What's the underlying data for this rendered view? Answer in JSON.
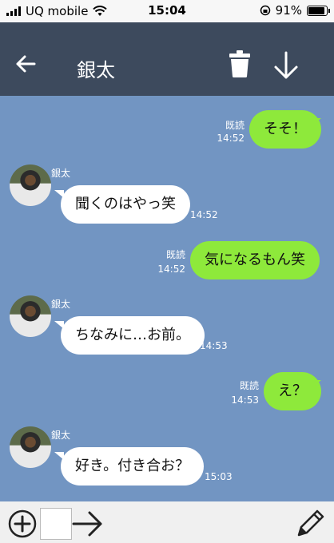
{
  "statusbar": {
    "carrier": "UQ mobile",
    "time": "15:04",
    "battery": "91%"
  },
  "header": {
    "title": "銀太"
  },
  "messages": [
    {
      "dir": "out",
      "text": "そそ！",
      "read": "既読",
      "time": "14:52"
    },
    {
      "dir": "in",
      "sender": "銀太",
      "text": "聞くのはやっ笑",
      "time": "14:52"
    },
    {
      "dir": "out",
      "text": "気になるもん笑",
      "read": "既読",
      "time": "14:52"
    },
    {
      "dir": "in",
      "sender": "銀太",
      "text": "ちなみに…お前。",
      "time": "14:53"
    },
    {
      "dir": "out",
      "text": "え？",
      "read": "既読",
      "time": "14:53"
    },
    {
      "dir": "in",
      "sender": "銀太",
      "text": "好き。付き合お？",
      "time": "15:03"
    }
  ],
  "icons": {
    "back": "arrow-left-icon",
    "trash": "trash-icon",
    "download": "arrow-down-icon",
    "plus": "plus-circle-icon",
    "send": "arrow-right-icon",
    "edit": "pencil-icon"
  },
  "colors": {
    "header": "#3d4a5d",
    "chat_bg": "#7295c2",
    "outgoing": "#8ee93b",
    "incoming": "#ffffff"
  }
}
